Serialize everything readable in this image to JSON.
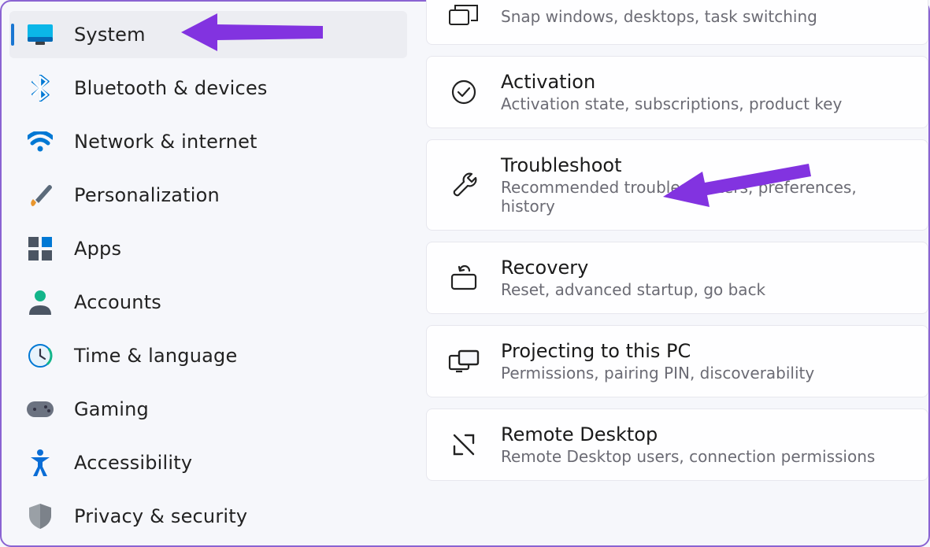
{
  "sidebar": {
    "items": [
      {
        "label": "System",
        "icon": "display-icon",
        "active": true
      },
      {
        "label": "Bluetooth & devices",
        "icon": "bluetooth-icon"
      },
      {
        "label": "Network & internet",
        "icon": "wifi-icon"
      },
      {
        "label": "Personalization",
        "icon": "brush-icon"
      },
      {
        "label": "Apps",
        "icon": "apps-icon"
      },
      {
        "label": "Accounts",
        "icon": "person-icon"
      },
      {
        "label": "Time & language",
        "icon": "clock-icon"
      },
      {
        "label": "Gaming",
        "icon": "gamepad-icon"
      },
      {
        "label": "Accessibility",
        "icon": "accessibility-icon"
      },
      {
        "label": "Privacy & security",
        "icon": "shield-icon"
      }
    ]
  },
  "main": {
    "cards": [
      {
        "title": "",
        "sub": "Snap windows, desktops, task switching",
        "icon": "multitask-icon"
      },
      {
        "title": "Activation",
        "sub": "Activation state, subscriptions, product key",
        "icon": "check-circle-icon"
      },
      {
        "title": "Troubleshoot",
        "sub": "Recommended troubleshooters, preferences, history",
        "icon": "wrench-icon"
      },
      {
        "title": "Recovery",
        "sub": "Reset, advanced startup, go back",
        "icon": "recovery-icon"
      },
      {
        "title": "Projecting to this PC",
        "sub": "Permissions, pairing PIN, discoverability",
        "icon": "project-icon"
      },
      {
        "title": "Remote Desktop",
        "sub": "Remote Desktop users, connection permissions",
        "icon": "remote-icon"
      }
    ]
  },
  "annotations": {
    "arrow1_target": "System",
    "arrow2_target": "Troubleshoot",
    "arrow_color": "#8233e0"
  }
}
